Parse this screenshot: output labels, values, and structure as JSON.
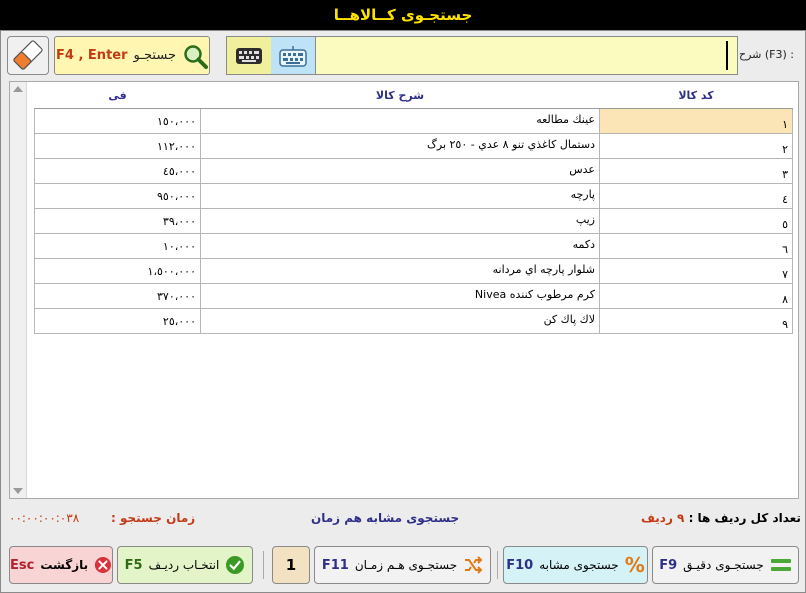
{
  "window": {
    "title": "جستجـوی کــالاهــا"
  },
  "search": {
    "label": "شرح (F3) :",
    "value": "",
    "button_label": "جستجـو",
    "button_keys": "F4 , Enter"
  },
  "grid": {
    "columns": {
      "code": "کد کالا",
      "desc": "شرح کالا",
      "price": "فی"
    },
    "rows": [
      {
        "code": "١",
        "desc": "عينك مطالعه",
        "price": "١٥٠،٠٠٠"
      },
      {
        "code": "٢",
        "desc": "دستمال كاغذي تنو ٨ عدي - ٢٥٠ برگ",
        "price": "١١٢،٠٠٠"
      },
      {
        "code": "٣",
        "desc": "عدس",
        "price": "٤٥،٠٠٠"
      },
      {
        "code": "٤",
        "desc": "پارچه",
        "price": "٩٥٠،٠٠٠"
      },
      {
        "code": "٥",
        "desc": "زيپ",
        "price": "٣٩،٠٠٠"
      },
      {
        "code": "٦",
        "desc": "دكمه",
        "price": "١٠،٠٠٠"
      },
      {
        "code": "٧",
        "desc": "شلوار پارچه اي مردانه",
        "price": "١،٥٠٠،٠٠٠"
      },
      {
        "code": "٨",
        "desc": "كرم مرطوب كننده Nivea",
        "price": "٣٧٠،٠٠٠"
      },
      {
        "code": "٩",
        "desc": "لاك پاك كن",
        "price": "٢٥،٠٠٠"
      }
    ]
  },
  "status": {
    "row_count_label": "تعداد کل ردیف ها :",
    "row_count_value": "٩ ردیف",
    "similar_concurrent": "جستجوی مشابه هم زمان",
    "time_label": "زمان جستجو :",
    "time_value": "٠٠:٠٠:٠٠:٠٣٨"
  },
  "buttons": {
    "exact_label": "جستجـوی دقیـق",
    "exact_key": "F9",
    "similar_label": "جستجوی مشابه",
    "similar_key": "F10",
    "concurrent_label": "جستجـوی هـم زمـان",
    "concurrent_key": "F11",
    "page": "1",
    "select_label": "انتخـاب ردیـف",
    "select_key": "F5",
    "back_label": "بازگشت",
    "back_key": "Esc"
  },
  "colors": {
    "title_text": "#ffe100",
    "accent_red": "#c23a16",
    "accent_blue": "#2f2f8a",
    "selected_row": "#fbe5b6"
  }
}
